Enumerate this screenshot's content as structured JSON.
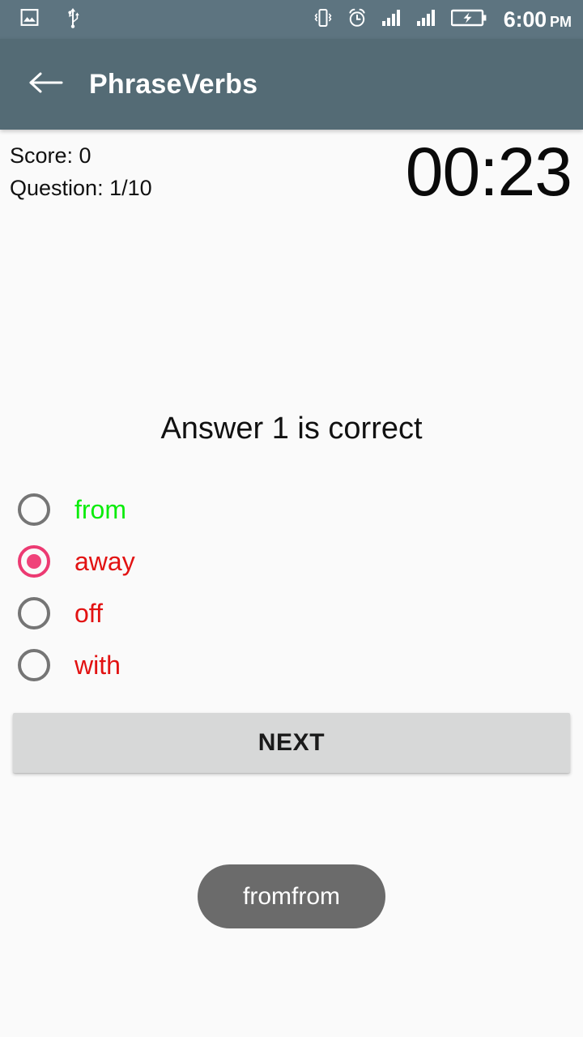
{
  "status_bar": {
    "background": "#5d7480",
    "left_icons": [
      {
        "name": "image-icon",
        "label": "image"
      },
      {
        "name": "usb-icon",
        "label": "usb"
      }
    ],
    "right_icons": [
      {
        "name": "vibrate-icon",
        "label": "vibrate"
      },
      {
        "name": "alarm-icon",
        "label": "alarm"
      },
      {
        "name": "signal-bars-icon-1",
        "label": "signal"
      },
      {
        "name": "signal-bars-icon-2",
        "label": "signal"
      },
      {
        "name": "battery-charging-icon",
        "label": "battery charging"
      }
    ],
    "clock": "6:00",
    "clock_period": "PM"
  },
  "app_bar": {
    "background": "#546b75",
    "back_icon": "back-arrow-icon",
    "title": "PhraseVerbs"
  },
  "quiz": {
    "score_label": "Score: 0",
    "question_counter": "Question: 1/10",
    "timer": "00:23",
    "prompt": "Answer 1 is correct",
    "options": [
      {
        "label": "from",
        "color": "#0bec0b",
        "selected": false
      },
      {
        "label": "away",
        "color": "#e21212",
        "selected": true
      },
      {
        "label": "off",
        "color": "#e21212",
        "selected": false
      },
      {
        "label": "with",
        "color": "#e21212",
        "selected": false
      }
    ],
    "radio_selected_color": "#ec3a72",
    "radio_unselected_color": "#757575",
    "next_label": "NEXT"
  },
  "toast": {
    "message": "fromfrom",
    "background": "#6b6b6b"
  }
}
